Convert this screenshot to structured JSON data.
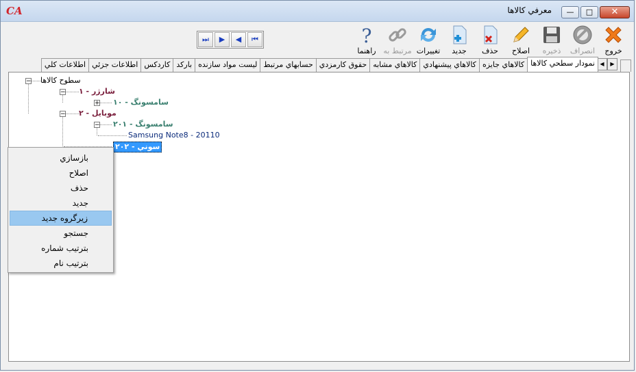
{
  "app": {
    "logo": "CA",
    "title": "معرفي کالاها"
  },
  "window_buttons": {
    "minimize": "—",
    "maximize": "□",
    "close": "✕"
  },
  "toolbar": [
    {
      "label": "خروج",
      "icon": "exit-x-icon",
      "enabled": true
    },
    {
      "label": "انصراف",
      "icon": "cancel-no-icon",
      "enabled": false
    },
    {
      "label": "ذخيره",
      "icon": "floppy-save-icon",
      "enabled": false
    },
    {
      "label": "اصلاح",
      "icon": "pencil-edit-icon",
      "enabled": true
    },
    {
      "label": "حذف",
      "icon": "document-delete-icon",
      "enabled": true
    },
    {
      "label": "جديد",
      "icon": "document-new-icon",
      "enabled": true
    },
    {
      "label": "تغييرات",
      "icon": "refresh-arrows-icon",
      "enabled": true
    },
    {
      "label": "مرتبط به",
      "icon": "chain-link-icon",
      "enabled": false
    },
    {
      "label": "راهنما",
      "icon": "question-help-icon",
      "enabled": true
    }
  ],
  "navigation": [
    "first",
    "previous",
    "next",
    "last"
  ],
  "tabs": [
    {
      "label": "نمودار سطحي کالاها",
      "active": true
    },
    {
      "label": "کالاهاي جايزه"
    },
    {
      "label": "کالاهاي پيشنهادي"
    },
    {
      "label": "کالاهاي مشابه"
    },
    {
      "label": "حقوق کارمزدي"
    },
    {
      "label": "حسابهاي مرتبط"
    },
    {
      "label": "ليست مواد سازنده"
    },
    {
      "label": "بارکد"
    },
    {
      "label": "کاردکس"
    },
    {
      "label": "اطلاعات جزئي"
    },
    {
      "label": "اطلاعات کلي"
    }
  ],
  "tree": {
    "root": "سطوح کالاها",
    "nodes": [
      {
        "label": "شارژر - ۱",
        "color": "#7a1f3d"
      },
      {
        "label": "سامسونگ - ۱۰",
        "color": "#3b8070"
      },
      {
        "label": "موبايل - ۲",
        "color": "#7a1f3d"
      },
      {
        "label": "سامسونگ - ۲۰۱",
        "color": "#3b8070"
      },
      {
        "label": "Samsung Note8 - 20110",
        "color": "#0a2a7a"
      },
      {
        "label": "سوني - ۲۰۲",
        "color": "#ffffff",
        "selected": true
      }
    ]
  },
  "context_menu": [
    {
      "label": "بازسازي"
    },
    {
      "label": "اصلاح"
    },
    {
      "label": "حذف"
    },
    {
      "label": "جديد"
    },
    {
      "label": "زيرگروه جديد",
      "highlighted": true
    },
    {
      "label": "جستجو"
    },
    {
      "label": "بترتيب شماره"
    },
    {
      "label": "بترتيب نام"
    }
  ]
}
